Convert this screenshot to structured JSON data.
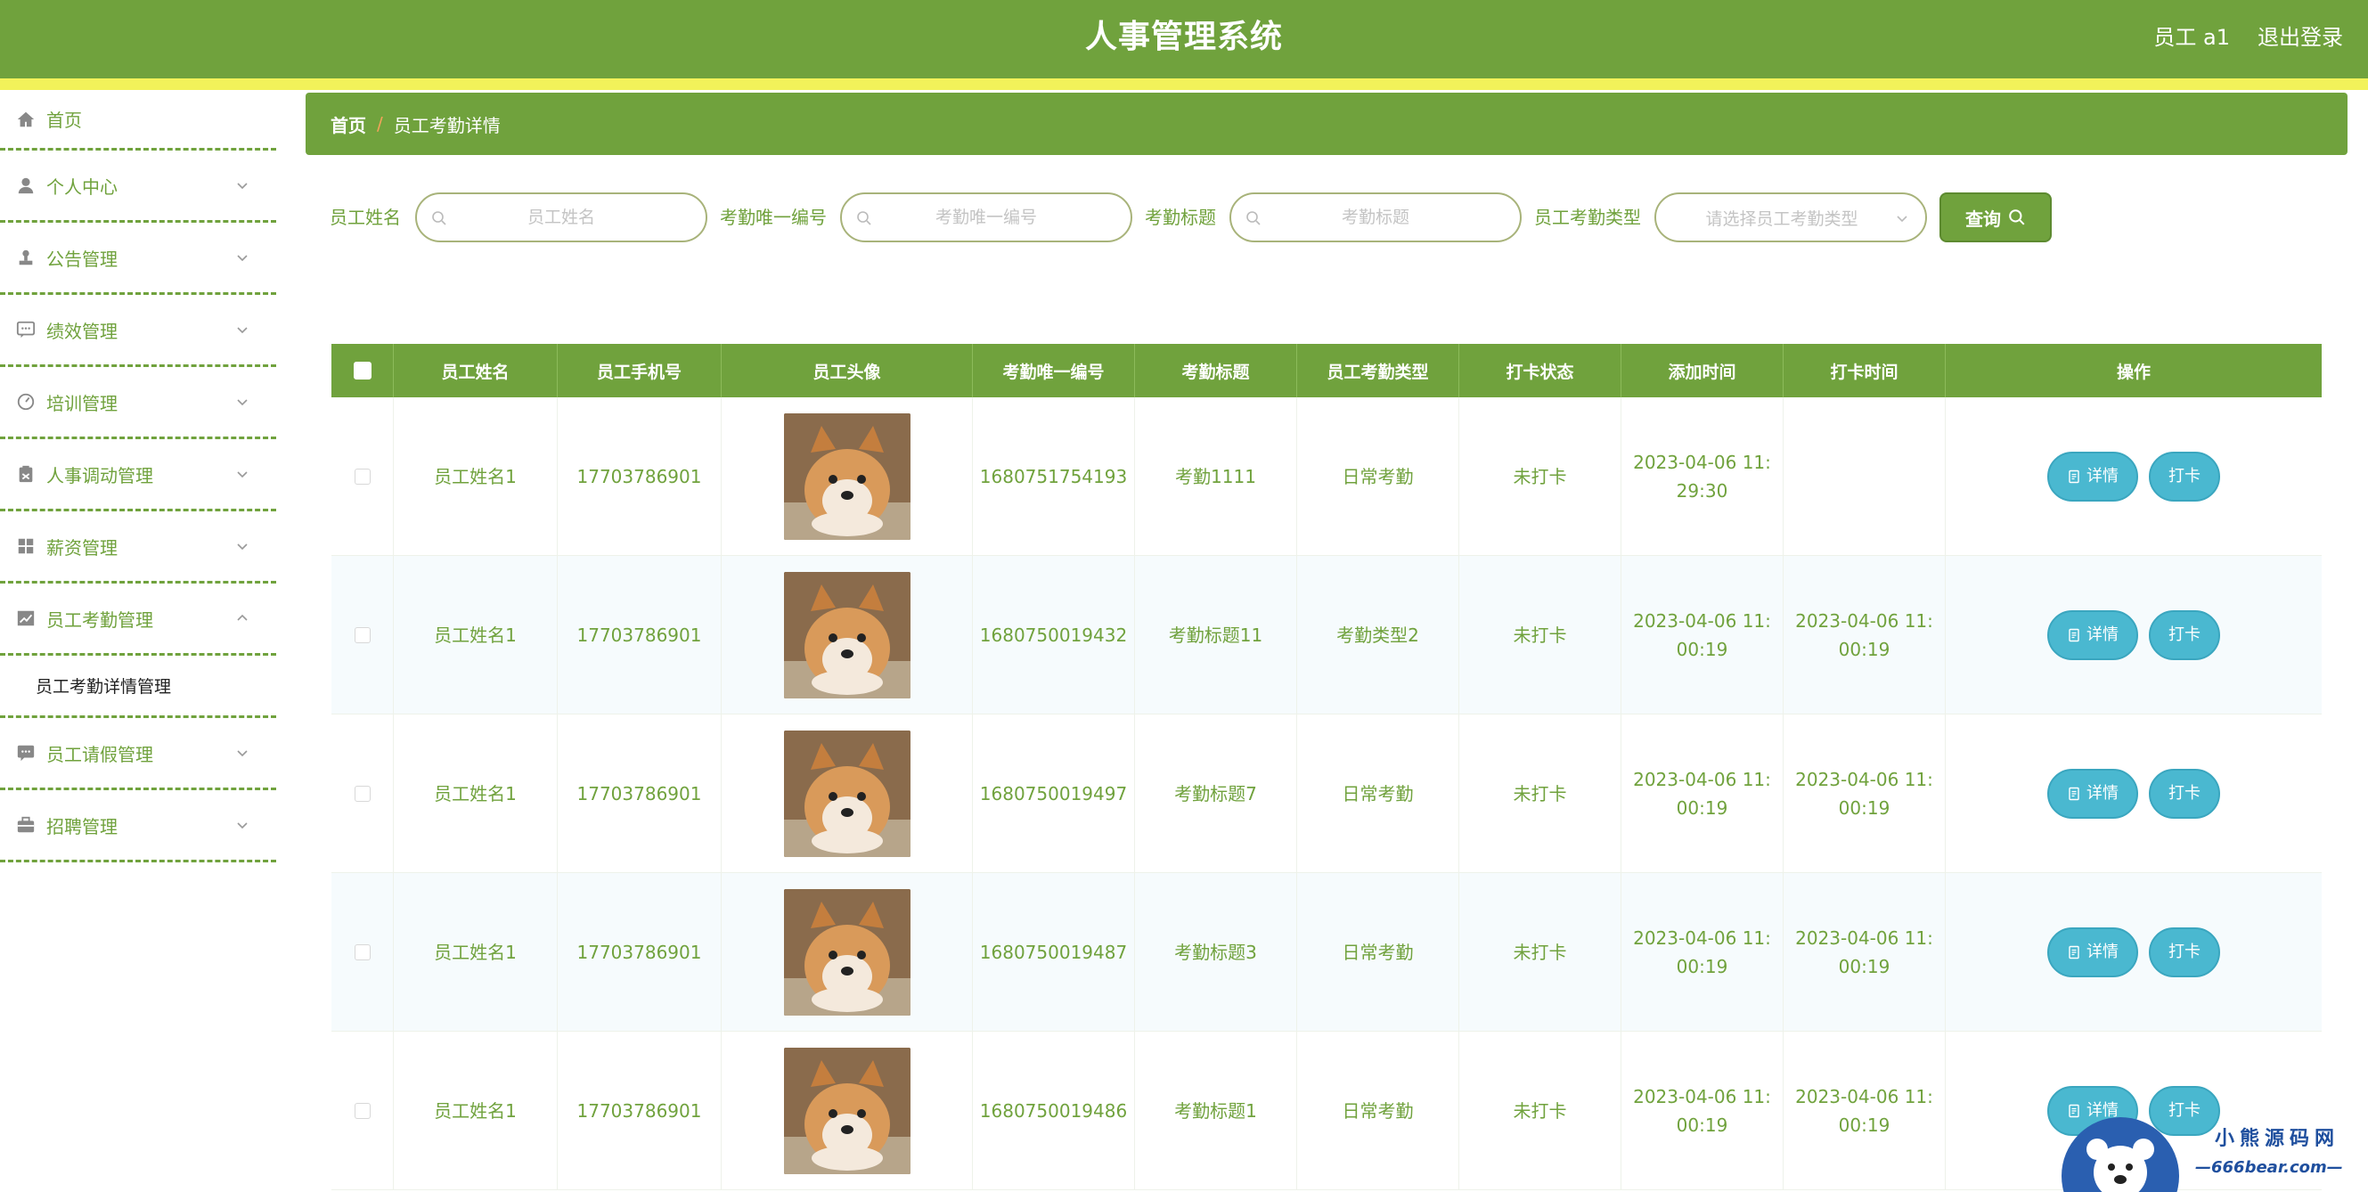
{
  "header": {
    "title": "人事管理系统",
    "user": "员工 a1",
    "logout": "退出登录"
  },
  "sidebar": {
    "items": [
      {
        "label": "首页",
        "icon": "home-icon"
      },
      {
        "label": "个人中心",
        "icon": "user-icon"
      },
      {
        "label": "公告管理",
        "icon": "stamp-icon"
      },
      {
        "label": "绩效管理",
        "icon": "chat-icon"
      },
      {
        "label": "培训管理",
        "icon": "gauge-icon"
      },
      {
        "label": "人事调动管理",
        "icon": "clipboard-icon"
      },
      {
        "label": "薪资管理",
        "icon": "grid-icon"
      },
      {
        "label": "员工考勤管理",
        "icon": "chart-icon"
      },
      {
        "label": "员工请假管理",
        "icon": "message-icon"
      },
      {
        "label": "招聘管理",
        "icon": "briefcase-icon"
      }
    ],
    "submenu": {
      "label": "员工考勤详情管理"
    }
  },
  "breadcrumb": {
    "home": "首页",
    "separator": "/",
    "current": "员工考勤详情"
  },
  "search": {
    "name_label": "员工姓名",
    "name_placeholder": "员工姓名",
    "code_label": "考勤唯一编号",
    "code_placeholder": "考勤唯一编号",
    "title_label": "考勤标题",
    "title_placeholder": "考勤标题",
    "type_label": "员工考勤类型",
    "type_placeholder": "请选择员工考勤类型",
    "button": "查询"
  },
  "table": {
    "headers": [
      "员工姓名",
      "员工手机号",
      "员工头像",
      "考勤唯一编号",
      "考勤标题",
      "员工考勤类型",
      "打卡状态",
      "添加时间",
      "打卡时间",
      "操作"
    ],
    "rows": [
      {
        "name": "员工姓名1",
        "phone": "17703786901",
        "code": "1680751754193",
        "title": "考勤1111",
        "type": "日常考勤",
        "status": "未打卡",
        "added": "2023-04-06 11:\n29:30",
        "clocked": ""
      },
      {
        "name": "员工姓名1",
        "phone": "17703786901",
        "code": "1680750019432",
        "title": "考勤标题11",
        "type": "考勤类型2",
        "status": "未打卡",
        "added": "2023-04-06 11:\n00:19",
        "clocked": "2023-04-06 11:\n00:19"
      },
      {
        "name": "员工姓名1",
        "phone": "17703786901",
        "code": "1680750019497",
        "title": "考勤标题7",
        "type": "日常考勤",
        "status": "未打卡",
        "added": "2023-04-06 11:\n00:19",
        "clocked": "2023-04-06 11:\n00:19"
      },
      {
        "name": "员工姓名1",
        "phone": "17703786901",
        "code": "1680750019487",
        "title": "考勤标题3",
        "type": "日常考勤",
        "status": "未打卡",
        "added": "2023-04-06 11:\n00:19",
        "clocked": "2023-04-06 11:\n00:19"
      },
      {
        "name": "员工姓名1",
        "phone": "17703786901",
        "code": "1680750019486",
        "title": "考勤标题1",
        "type": "日常考勤",
        "status": "未打卡",
        "added": "2023-04-06 11:\n00:19",
        "clocked": "2023-04-06 11:\n00:19"
      }
    ],
    "detail_label": "详情",
    "clock_label": "打卡"
  },
  "watermark": {
    "line1": "小熊源码网",
    "line2": "—666bear.com—"
  },
  "colors": {
    "primary": "#70a23d",
    "stripe": "#f2f25a",
    "action": "#4ab8d0"
  }
}
